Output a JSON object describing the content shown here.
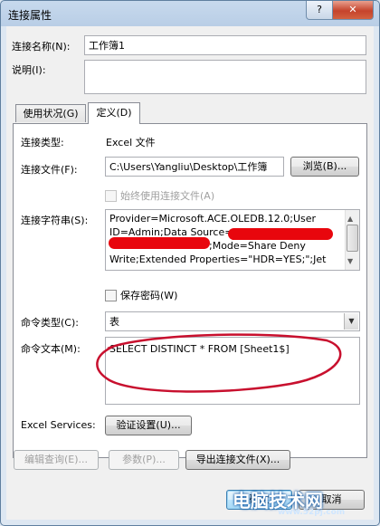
{
  "window": {
    "title": "连接属性",
    "help_glyph": "?",
    "close_glyph": "✕"
  },
  "connection_name": {
    "label": "连接名称(N):",
    "value": "工作簿1"
  },
  "description": {
    "label": "说明(I):",
    "value": ""
  },
  "tabs": [
    {
      "label": "使用状况(G)",
      "active": false
    },
    {
      "label": "定义(D)",
      "active": true
    }
  ],
  "definition": {
    "connection_type": {
      "label": "连接类型:",
      "value": "Excel 文件"
    },
    "connection_file": {
      "label": "连接文件(F):",
      "value": "C:\\Users\\Yangliu\\Desktop\\工作簿",
      "browse": "浏览(B)..."
    },
    "always_use_file": {
      "label": "始终使用连接文件(A)",
      "checked": false
    },
    "connection_string": {
      "label": "连接字符串(S):",
      "lines": [
        "Provider=Microsoft.ACE.OLEDB.12.0;User",
        "ID=Admin;Data Source=",
        ";Mode=Share Deny",
        "Write;Extended Properties=\"HDR=YES;\";Jet"
      ]
    },
    "save_password": {
      "label": "保存密码(W)",
      "checked": false
    },
    "command_type": {
      "label": "命令类型(C):",
      "value": "表"
    },
    "command_text": {
      "label": "命令文本(M):",
      "value": "SELECT DISTINCT * FROM [Sheet1$]"
    },
    "excel_services": {
      "label": "Excel Services:",
      "button": "验证设置(U)..."
    },
    "edit_query": "编辑查询(E)...",
    "parameters": "参数(P)...",
    "export_file": "导出连接文件(X)..."
  },
  "footer": {
    "ok": "确定",
    "cancel": "取消"
  },
  "watermark": {
    "text": "电脑技术网",
    "url": "www.52pj.com"
  },
  "colors": {
    "redaction": "#e8060d",
    "title_gradient": "#b9cee6"
  }
}
